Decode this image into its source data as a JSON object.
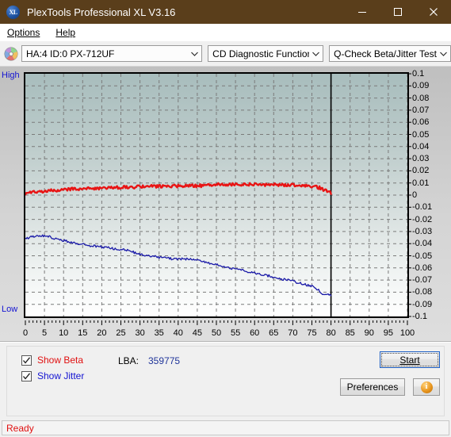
{
  "window": {
    "title": "PlexTools Professional XL V3.16",
    "icon": "app-xl-icon",
    "minimize_label": "─",
    "maximize_label": "☐",
    "close_label": "✕",
    "titlebar_color": "#5a3e1b"
  },
  "menubar": {
    "items": [
      {
        "label": "Options",
        "accel": "O"
      },
      {
        "label": "Help",
        "accel": "H"
      }
    ]
  },
  "toolbar": {
    "drive_icon": "disc-icon",
    "drive_combo": {
      "value": "HA:4 ID:0  PX-712UF",
      "arrow": "chevron-down-icon"
    },
    "function_combo": {
      "value": "CD Diagnostic Functions",
      "arrow": "chevron-down-icon"
    },
    "test_combo": {
      "value": "Q-Check Beta/Jitter Test",
      "arrow": "chevron-down-icon"
    }
  },
  "chart_labels": {
    "high": "High",
    "low": "Low"
  },
  "controls": {
    "show_beta": {
      "label": "Show Beta",
      "accel": "B",
      "checked": true,
      "color": "#e01010"
    },
    "show_jitter": {
      "label": "Show Jitter",
      "accel": "J",
      "checked": true,
      "color": "#1414d2"
    },
    "lba_label": "LBA:",
    "lba_value": "359775",
    "start_button": "Start",
    "preferences_button": "Preferences",
    "info_button": "i"
  },
  "statusbar": {
    "text": "Ready"
  },
  "chart_data": {
    "type": "line",
    "title": "Q-Check Beta/Jitter Test",
    "xlabel": "",
    "ylabel": "",
    "xlim": [
      0,
      100
    ],
    "ylim": [
      -0.1,
      0.1
    ],
    "grid": true,
    "legend_position": "below-plot",
    "x_ticks": [
      0,
      5,
      10,
      15,
      20,
      25,
      30,
      35,
      40,
      45,
      50,
      55,
      60,
      65,
      70,
      75,
      80,
      85,
      90,
      95,
      100
    ],
    "y_ticks": [
      0.1,
      0.09,
      0.08,
      0.07,
      0.06,
      0.05,
      0.04,
      0.03,
      0.02,
      0.01,
      0,
      -0.01,
      -0.02,
      -0.03,
      -0.04,
      -0.05,
      -0.06,
      -0.07,
      -0.08,
      -0.09,
      -0.1
    ],
    "y_tick_labels": [
      "0.1",
      "0.09",
      "0.08",
      "0.07",
      "0.06",
      "0.05",
      "0.04",
      "0.03",
      "0.02",
      "0.01",
      "0",
      "-0.01",
      "-0.02",
      "-0.03",
      "-0.04",
      "-0.05",
      "-0.06",
      "-0.07",
      "-0.08",
      "-0.09",
      "-0.1"
    ],
    "left_axis_top_label": "High",
    "left_axis_bottom_label": "Low",
    "data_end_marker_x": 80,
    "series": [
      {
        "name": "Beta",
        "color": "#e81414",
        "x": [
          0,
          1,
          2,
          3,
          4,
          5,
          6,
          7,
          8,
          9,
          10,
          11,
          12,
          13,
          14,
          15,
          16,
          17,
          18,
          19,
          20,
          21,
          22,
          23,
          24,
          25,
          26,
          27,
          28,
          29,
          30,
          31,
          32,
          33,
          34,
          35,
          36,
          37,
          38,
          39,
          40,
          41,
          42,
          43,
          44,
          45,
          46,
          47,
          48,
          49,
          50,
          51,
          52,
          53,
          54,
          55,
          56,
          57,
          58,
          59,
          60,
          61,
          62,
          63,
          64,
          65,
          66,
          67,
          68,
          69,
          70,
          71,
          72,
          73,
          74,
          75,
          76,
          77,
          78,
          79,
          80
        ],
        "values": [
          0.0018,
          0.0022,
          0.0025,
          0.0027,
          0.003,
          0.0032,
          0.0035,
          0.0038,
          0.0041,
          0.0043,
          0.0044,
          0.0046,
          0.0048,
          0.005,
          0.0051,
          0.0053,
          0.0054,
          0.0056,
          0.0057,
          0.0058,
          0.006,
          0.0061,
          0.0062,
          0.0063,
          0.0064,
          0.0065,
          0.0066,
          0.0066,
          0.0067,
          0.0068,
          0.0069,
          0.007,
          0.007,
          0.0071,
          0.0072,
          0.0072,
          0.0073,
          0.0074,
          0.0074,
          0.0075,
          0.0075,
          0.0076,
          0.0076,
          0.0077,
          0.0077,
          0.0078,
          0.0078,
          0.0085,
          0.0086,
          0.0086,
          0.0087,
          0.0087,
          0.0088,
          0.0088,
          0.0088,
          0.0088,
          0.0088,
          0.0088,
          0.0088,
          0.0088,
          0.0088,
          0.0087,
          0.0087,
          0.0087,
          0.0086,
          0.0086,
          0.0086,
          0.0085,
          0.0085,
          0.0084,
          0.0084,
          0.0083,
          0.0082,
          0.0081,
          0.0079,
          0.0076,
          0.007,
          0.006,
          0.0046,
          0.003,
          0.0016
        ]
      },
      {
        "name": "Jitter",
        "color": "#1a1aa8",
        "x": [
          0,
          1,
          2,
          3,
          4,
          5,
          6,
          7,
          8,
          9,
          10,
          11,
          12,
          13,
          14,
          15,
          16,
          17,
          18,
          19,
          20,
          21,
          22,
          23,
          24,
          25,
          26,
          27,
          28,
          29,
          30,
          31,
          32,
          33,
          34,
          35,
          36,
          37,
          38,
          39,
          40,
          41,
          42,
          43,
          44,
          45,
          46,
          47,
          48,
          49,
          50,
          51,
          52,
          53,
          54,
          55,
          56,
          57,
          58,
          59,
          60,
          61,
          62,
          63,
          64,
          65,
          66,
          67,
          68,
          69,
          70,
          71,
          72,
          73,
          74,
          75,
          76,
          77,
          78,
          79,
          80
        ],
        "values": [
          -0.036,
          -0.035,
          -0.034,
          -0.0333,
          -0.0336,
          -0.0334,
          -0.0341,
          -0.035,
          -0.036,
          -0.0369,
          -0.0376,
          -0.038,
          -0.039,
          -0.0396,
          -0.04,
          -0.0406,
          -0.0412,
          -0.0418,
          -0.042,
          -0.0424,
          -0.0428,
          -0.043,
          -0.0436,
          -0.044,
          -0.0443,
          -0.0448,
          -0.0452,
          -0.0458,
          -0.0467,
          -0.048,
          -0.049,
          -0.0492,
          -0.0497,
          -0.05,
          -0.0506,
          -0.0512,
          -0.0509,
          -0.052,
          -0.0524,
          -0.0522,
          -0.0527,
          -0.0526,
          -0.0528,
          -0.0528,
          -0.053,
          -0.0531,
          -0.054,
          -0.0552,
          -0.0558,
          -0.0564,
          -0.0574,
          -0.0578,
          -0.059,
          -0.0598,
          -0.0605,
          -0.0612,
          -0.0605,
          -0.062,
          -0.0628,
          -0.0634,
          -0.064,
          -0.0648,
          -0.0652,
          -0.066,
          -0.0668,
          -0.0676,
          -0.0682,
          -0.069,
          -0.0697,
          -0.0702,
          -0.071,
          -0.0718,
          -0.0726,
          -0.0735,
          -0.0744,
          -0.0752,
          -0.0766,
          -0.079,
          -0.0818,
          -0.082,
          -0.0826
        ]
      }
    ]
  }
}
